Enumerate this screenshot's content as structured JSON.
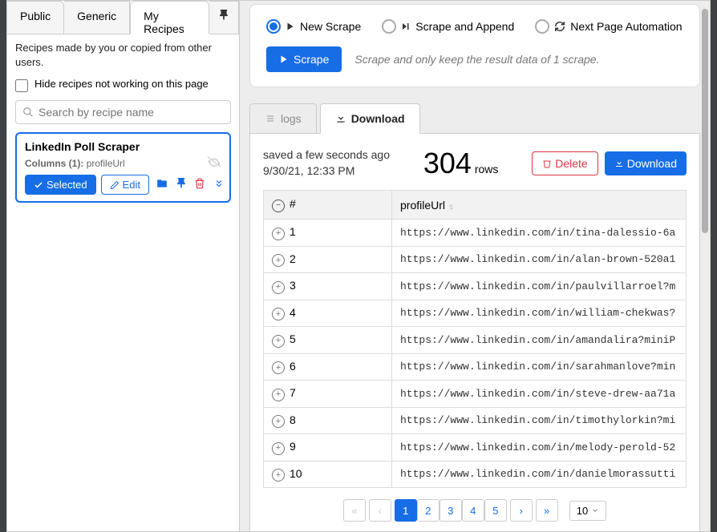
{
  "sidebar": {
    "tabs": {
      "public": "Public",
      "generic": "Generic",
      "my_recipes": "My Recipes"
    },
    "description": "Recipes made by you or copied from other users.",
    "hide_label": "Hide recipes not working on this page",
    "search_placeholder": "Search by recipe name",
    "recipe": {
      "title": "LinkedIn Poll Scraper",
      "columns_label": "Columns (1):",
      "columns_value": "profileUrl",
      "selected_label": "Selected",
      "edit_label": "Edit"
    }
  },
  "main": {
    "radios": {
      "new_scrape": "New Scrape",
      "scrape_append": "Scrape and Append",
      "next_page": "Next Page Automation"
    },
    "scrape_button": "Scrape",
    "scrape_hint": "Scrape and only keep the result data of 1 scrape.",
    "tabs": {
      "logs": "logs",
      "download": "Download"
    },
    "saved_line1": "saved a few seconds ago",
    "saved_line2": "9/30/21, 12:33 PM",
    "row_count": "304",
    "rows_label": "rows",
    "delete_label": "Delete",
    "download_label": "Download",
    "table": {
      "col_num": "#",
      "col_url": "profileUrl",
      "rows": [
        {
          "n": "1",
          "url": "https://www.linkedin.com/in/tina-dalessio-6a"
        },
        {
          "n": "2",
          "url": "https://www.linkedin.com/in/alan-brown-520a1"
        },
        {
          "n": "3",
          "url": "https://www.linkedin.com/in/paulvillarroel?m"
        },
        {
          "n": "4",
          "url": "https://www.linkedin.com/in/william-chekwas?"
        },
        {
          "n": "5",
          "url": "https://www.linkedin.com/in/amandalira?miniP"
        },
        {
          "n": "6",
          "url": "https://www.linkedin.com/in/sarahmanlove?min"
        },
        {
          "n": "7",
          "url": "https://www.linkedin.com/in/steve-drew-aa71a"
        },
        {
          "n": "8",
          "url": "https://www.linkedin.com/in/timothylorkin?mi"
        },
        {
          "n": "9",
          "url": "https://www.linkedin.com/in/melody-perold-52"
        },
        {
          "n": "10",
          "url": "https://www.linkedin.com/in/danielmorassutti"
        }
      ]
    },
    "pagination": {
      "pages": [
        "1",
        "2",
        "3",
        "4",
        "5"
      ],
      "page_size": "10"
    }
  }
}
